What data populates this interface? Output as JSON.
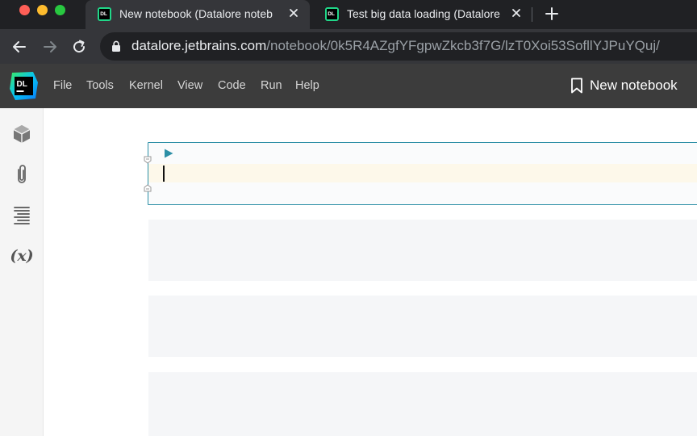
{
  "browser": {
    "tabs": [
      {
        "title": "New notebook (Datalore noteb",
        "active": true
      },
      {
        "title": "Test big data loading (Datalore",
        "active": false
      }
    ],
    "url": {
      "host": "datalore.jetbrains.com",
      "path": "/notebook/0k5R4AZgfYFgpwZkcb3f7G/lzT0Xoi53SofllYJPuYQuj/"
    }
  },
  "app": {
    "logo_text": "DL",
    "menu": [
      "File",
      "Tools",
      "Kernel",
      "View",
      "Code",
      "Run",
      "Help"
    ],
    "notebook_title": "New notebook"
  },
  "sidebar": {
    "items": [
      {
        "icon": "cube-icon"
      },
      {
        "icon": "paperclip-icon"
      },
      {
        "icon": "outline-icon"
      },
      {
        "icon": "variables-icon",
        "label": "(x)"
      }
    ]
  },
  "colors": {
    "accent": "#2d8fa6",
    "header_bg": "#3c3c3c",
    "editor_line": "#fdf8ea"
  }
}
